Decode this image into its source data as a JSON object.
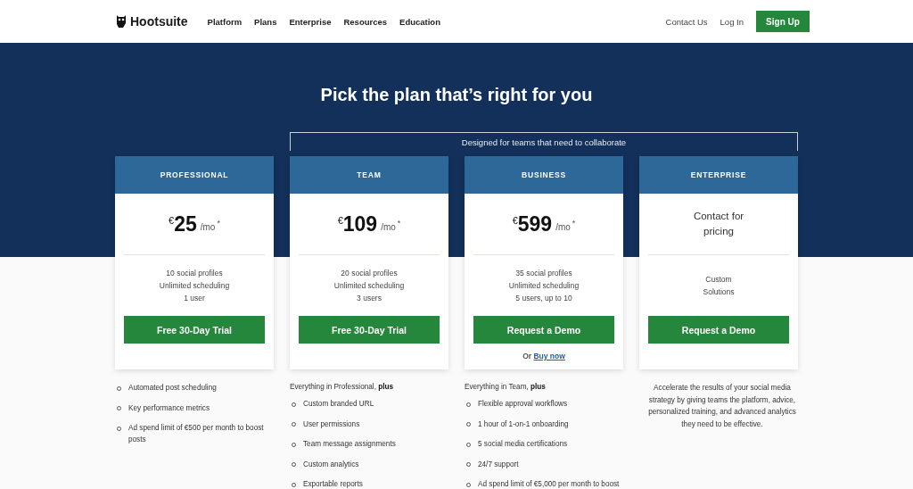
{
  "header": {
    "logo": "Hootsuite",
    "nav": [
      "Platform",
      "Plans",
      "Enterprise",
      "Resources",
      "Education"
    ],
    "links": [
      "Contact Us",
      "Log In"
    ],
    "signup": "Sign Up"
  },
  "title": "Pick the plan that’s right for you",
  "banner": "Designed for teams that need to collaborate",
  "plans": [
    {
      "name": "PROFESSIONAL",
      "kind": "price",
      "currency": "€",
      "amount": "25",
      "unit": "/mo",
      "mark": "*",
      "highlights": [
        "10 social profiles",
        "Unlimited scheduling",
        "1 user"
      ],
      "button": "Free 30-Day Trial",
      "features": {
        "kind": "list",
        "items": [
          "Automated post scheduling",
          "Key performance metrics",
          "Ad spend limit of €500 per month to boost posts"
        ]
      }
    },
    {
      "name": "TEAM",
      "kind": "price",
      "currency": "€",
      "amount": "109",
      "unit": "/mo",
      "mark": "*",
      "highlights": [
        "20 social profiles",
        "Unlimited scheduling",
        "3 users"
      ],
      "button": "Free 30-Day Trial",
      "features": {
        "kind": "list",
        "intro": "Everything in Professional, **plus**",
        "items": [
          "Custom branded URL",
          "User permissions",
          "Team message assignments",
          "Custom analytics",
          "Exportable reports"
        ]
      }
    },
    {
      "name": "BUSINESS",
      "kind": "price",
      "currency": "€",
      "amount": "599",
      "unit": "/mo",
      "mark": "*",
      "highlights": [
        "35 social profiles",
        "Unlimited scheduling",
        "5 users, up to 10"
      ],
      "button": "Request a Demo",
      "alt": {
        "prefix": "Or",
        "link": "Buy now"
      },
      "features": {
        "kind": "list",
        "intro": "Everything in Team, **plus**",
        "items": [
          "Flexible approval workflows",
          "1 hour of 1-on-1 onboarding",
          "5 social media certifications",
          "24/7 support",
          "Ad spend limit of €5,000 per month to boost"
        ]
      }
    },
    {
      "name": "ENTERPRISE",
      "kind": "contact",
      "contact": "Contact for pricing",
      "highlights": [
        "Custom Solutions"
      ],
      "button": "Request a Demo",
      "features": {
        "kind": "paragraph",
        "text": "Accelerate the results of your social media strategy by giving teams the platform, advice, personalized training, and advanced analytics they need to be effective."
      }
    }
  ]
}
